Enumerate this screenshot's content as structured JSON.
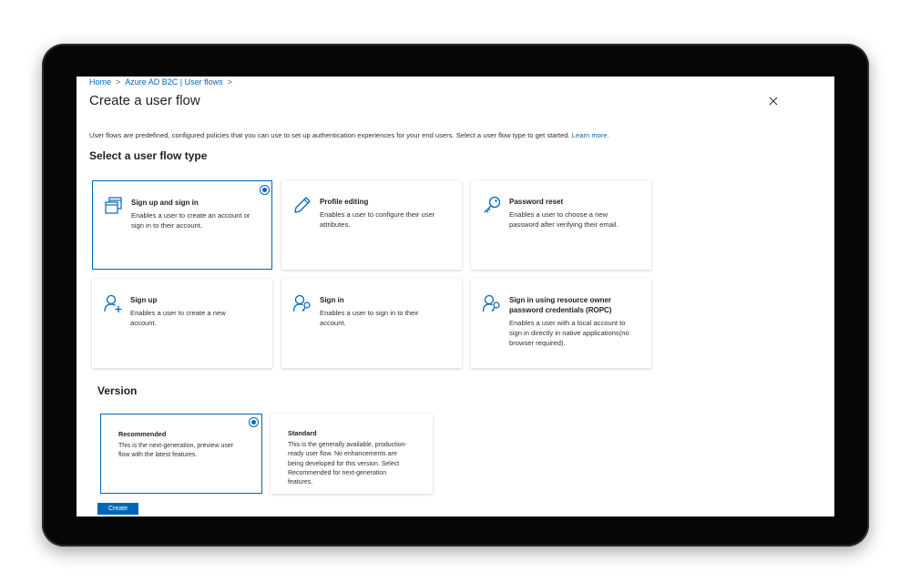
{
  "breadcrumb": {
    "home": "Home",
    "parent": "Azure AD B2C | User flows",
    "sep": ">"
  },
  "page_title": "Create a user flow",
  "intro": {
    "text": "User flows are predefined, configured policies that you can use to set up authentication experiences for your end users. Select a user flow type to get started.",
    "link": "Learn more."
  },
  "flow_type_heading": "Select a user flow type",
  "flow_types": [
    {
      "title": "Sign up and sign in",
      "description": "Enables a user to create an account or sign in to their account.",
      "icon": "windows-stack-icon",
      "selected": true
    },
    {
      "title": "Profile editing",
      "description": "Enables a user to configure their user attributes.",
      "icon": "pencil-icon",
      "selected": false
    },
    {
      "title": "Password reset",
      "description": "Enables a user to choose a new password after verifying their email.",
      "icon": "key-icon",
      "selected": false
    },
    {
      "title": "Sign up",
      "description": "Enables a user to create a new account.",
      "icon": "user-add-icon",
      "selected": false
    },
    {
      "title": "Sign in",
      "description": "Enables a user to sign in to their account.",
      "icon": "user-key-icon",
      "selected": false
    },
    {
      "title": "Sign in using resource owner password credentials (ROPC)",
      "description": "Enables a user with a local account to sign in directly in native applications(no browser required).",
      "icon": "user-key-icon",
      "selected": false
    }
  ],
  "version_heading": "Version",
  "versions": [
    {
      "title": "Recommended",
      "description": "This is the next-generation, preview user flow with the latest features.",
      "selected": true
    },
    {
      "title": "Standard",
      "description": "This is the generally available, production-ready user flow. No enhancements are being developed for this version. Select Recommended for next-generation features.",
      "selected": false
    }
  ],
  "create_label": "Create",
  "colors": {
    "accent": "#0067b8",
    "bezel": "#060606",
    "text": "#201f1e"
  }
}
